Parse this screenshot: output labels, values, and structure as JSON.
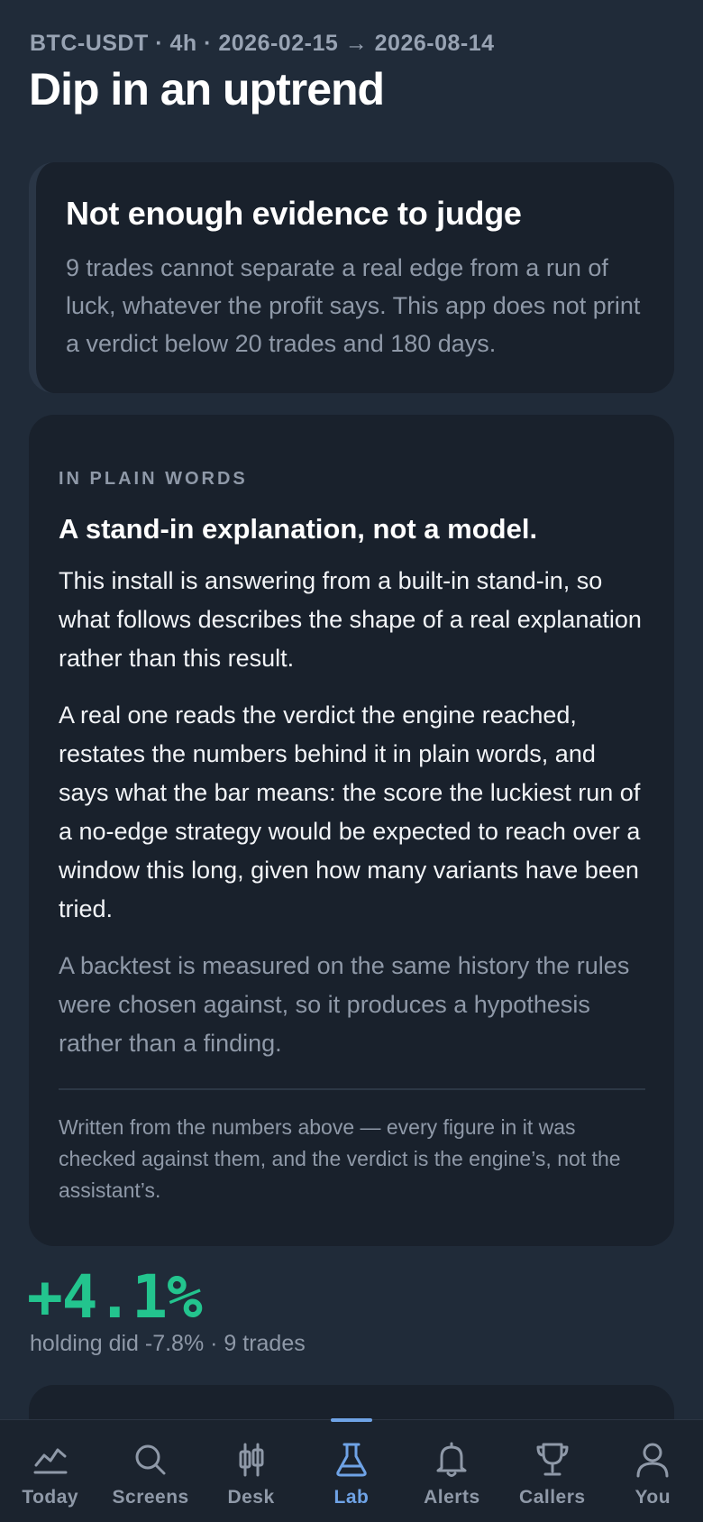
{
  "header": {
    "meta": "BTC-USDT · 4h · 2026-02-15 → 2026-08-14",
    "title": "Dip in an uptrend"
  },
  "verdict": {
    "heading": "Not enough evidence to judge",
    "body": "9 trades cannot separate a real edge from a run of luck, whatever the profit says. This app does not print a verdict below 20 trades and 180 days."
  },
  "plain_words": {
    "label": "IN PLAIN WORDS",
    "heading": "A stand-in explanation, not a model.",
    "para1": "This install is answering from a built-in stand-in, so what follows describes the shape of a real explanation rather than this result.",
    "para2": "A real one reads the verdict the engine reached, restates the numbers behind it in plain words, and says what the bar means: the score the luckiest run of a no-edge strategy would be expected to reach over a window this long, given how many variants have been tried.",
    "para3": "A backtest is measured on the same history the rules were chosen against, so it produces a hypothesis rather than a finding.",
    "footnote": "Written from the numbers above — every figure in it was checked against them, and the verdict is the engine’s, not the assistant’s."
  },
  "result": {
    "return": "+4.1%",
    "summary": "holding did -7.8% · 9 trades"
  },
  "tabs": [
    {
      "label": "Today",
      "icon": "chart-line-icon",
      "active": false
    },
    {
      "label": "Screens",
      "icon": "search-icon",
      "active": false
    },
    {
      "label": "Desk",
      "icon": "candlestick-icon",
      "active": false
    },
    {
      "label": "Lab",
      "icon": "flask-icon",
      "active": true
    },
    {
      "label": "Alerts",
      "icon": "bell-icon",
      "active": false
    },
    {
      "label": "Callers",
      "icon": "trophy-icon",
      "active": false
    },
    {
      "label": "You",
      "icon": "user-icon",
      "active": false
    }
  ],
  "colors": {
    "background": "#202b39",
    "card": "#19212c",
    "accent": "#6fa3e6",
    "positive": "#23c48e",
    "muted_text": "#8f99a8"
  }
}
